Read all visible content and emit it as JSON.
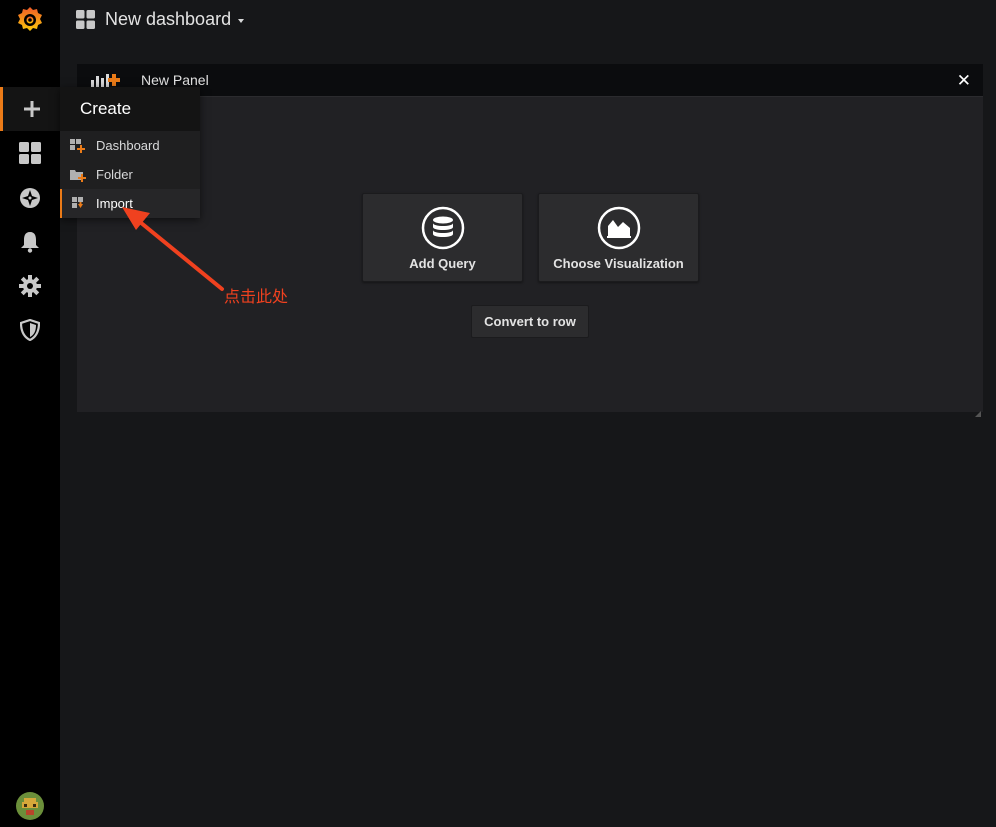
{
  "navbar": {
    "title": "New dashboard"
  },
  "sidebar": {
    "items": [
      {
        "name": "create",
        "icon": "plus-icon"
      },
      {
        "name": "dashboards",
        "icon": "dashboard-grid-icon"
      },
      {
        "name": "explore",
        "icon": "compass-icon"
      },
      {
        "name": "alerting",
        "icon": "bell-icon"
      },
      {
        "name": "configuration",
        "icon": "gear-icon"
      },
      {
        "name": "server-admin",
        "icon": "shield-icon"
      }
    ]
  },
  "create_menu": {
    "header": "Create",
    "items": [
      {
        "label": "Dashboard",
        "icon": "dashboard-add-icon"
      },
      {
        "label": "Folder",
        "icon": "folder-add-icon"
      },
      {
        "label": "Import",
        "icon": "import-icon"
      }
    ]
  },
  "panel": {
    "title": "New Panel",
    "close": "✕",
    "actions": [
      {
        "label": "Add Query",
        "icon": "database-icon"
      },
      {
        "label": "Choose Visualization",
        "icon": "area-chart-icon"
      }
    ],
    "convert_label": "Convert to row"
  },
  "annotation": {
    "text": "点击此处",
    "color": "#f0411f"
  },
  "colors": {
    "accent": "#eb7b18",
    "background": "#161719",
    "sidebar": "#000000",
    "panel": "#212124"
  }
}
